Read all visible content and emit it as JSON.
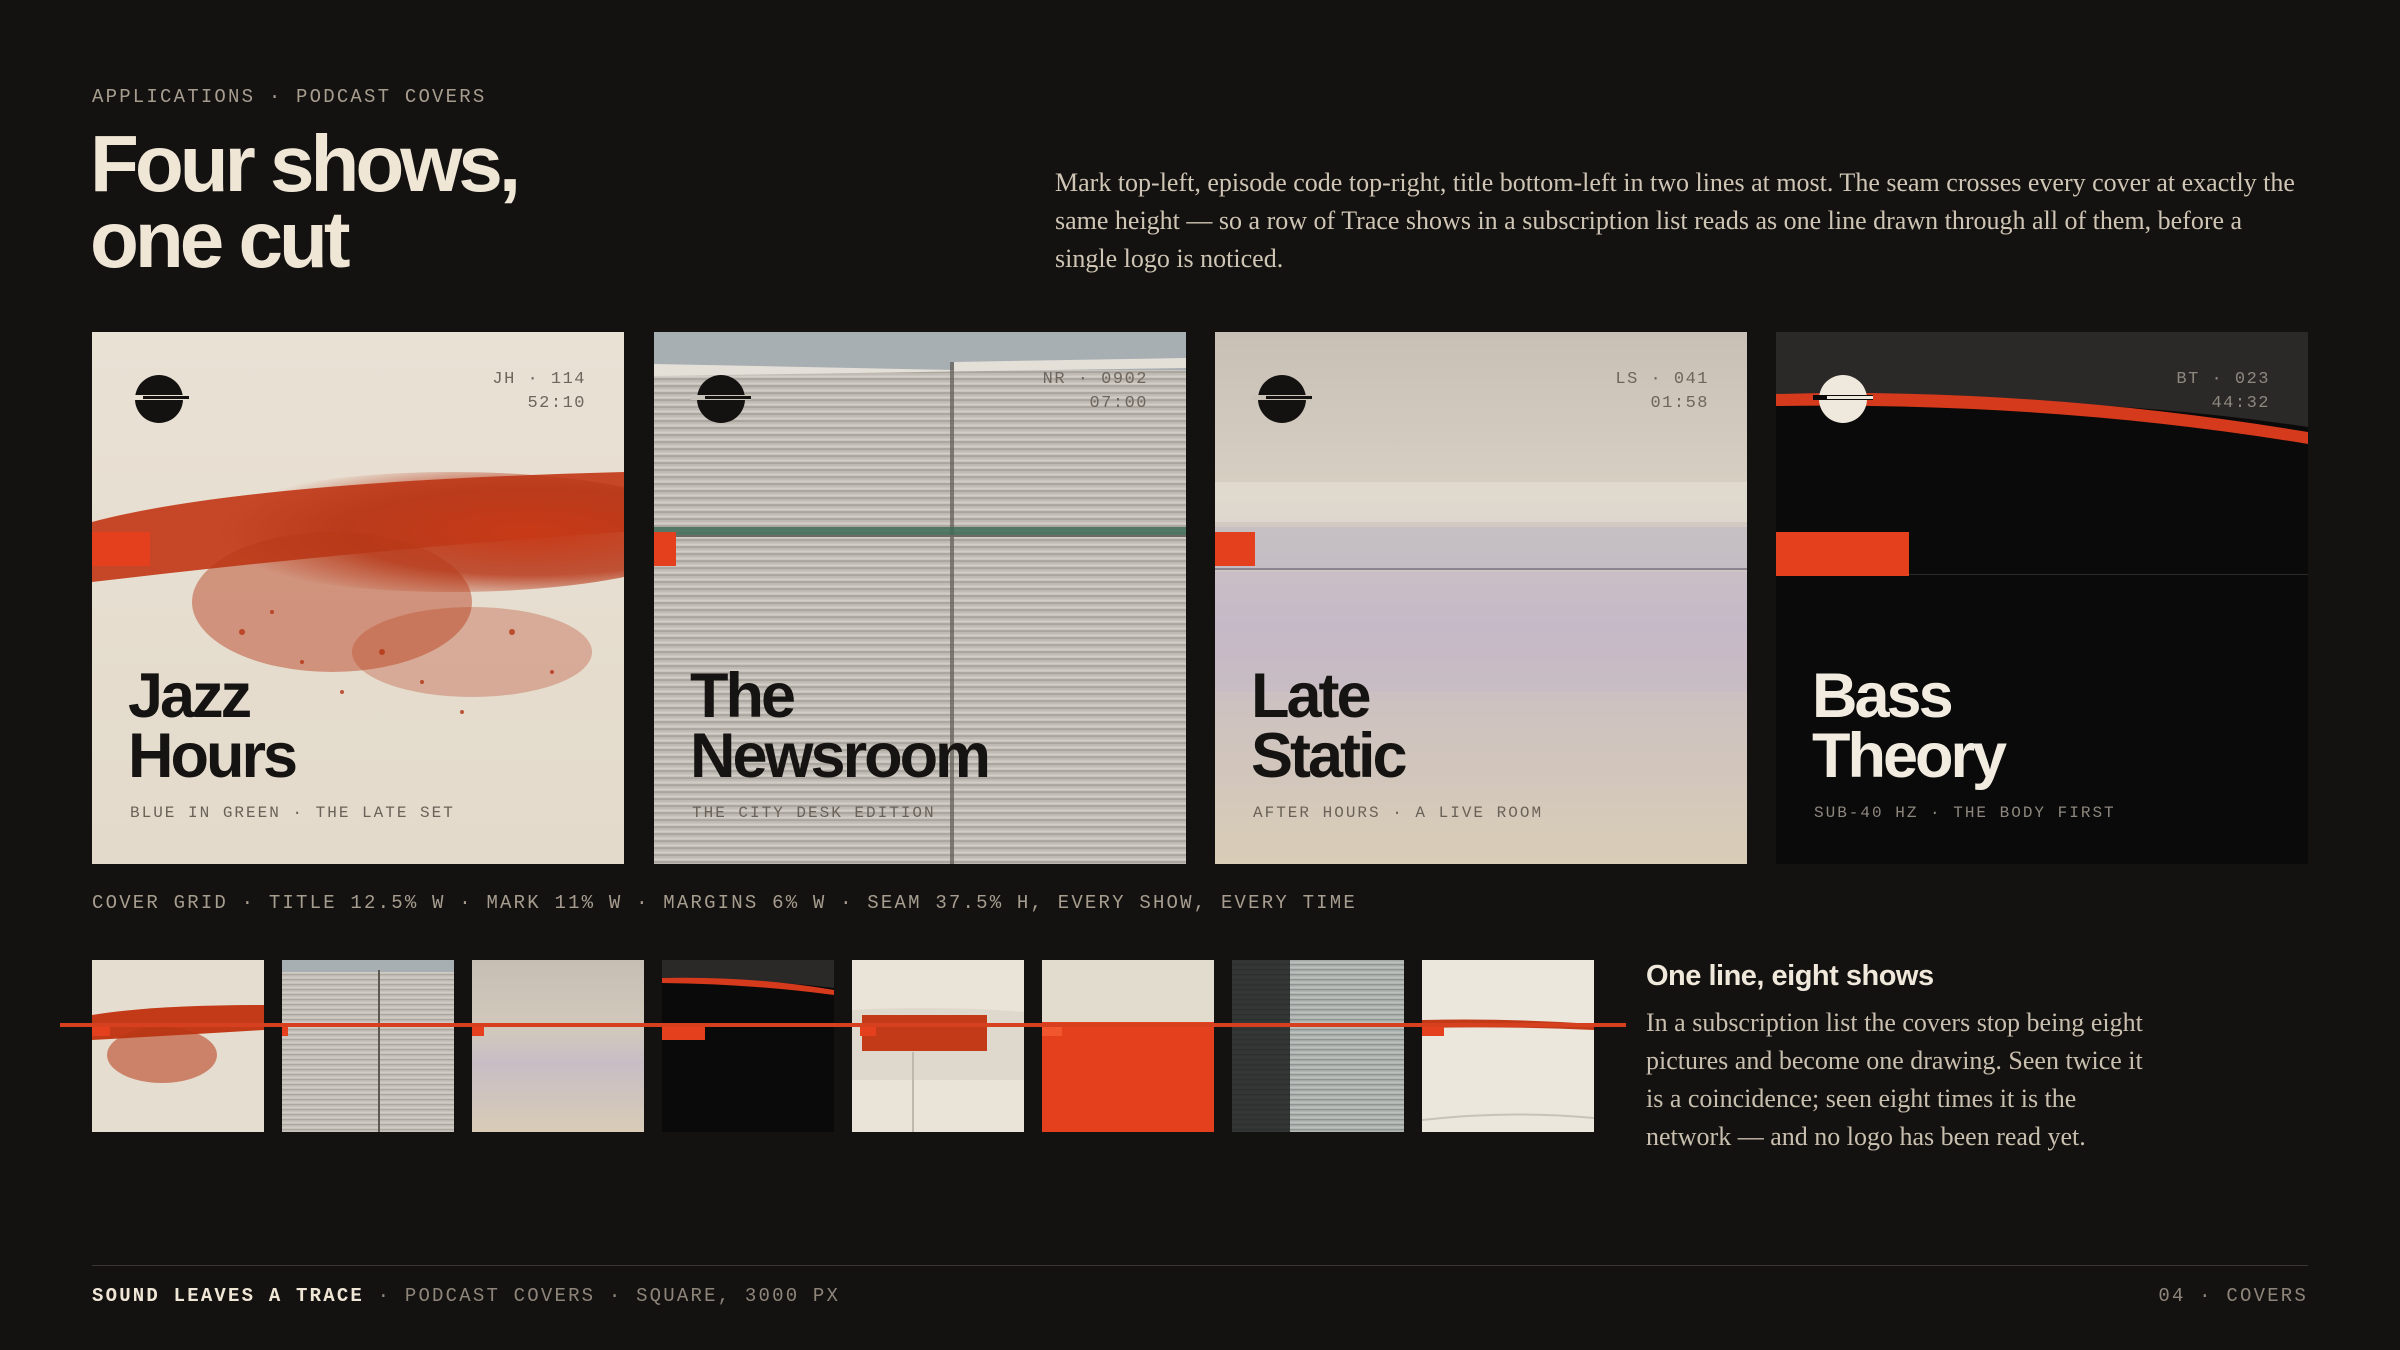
{
  "header": {
    "eyebrow": "APPLICATIONS · PODCAST COVERS",
    "title_line1": "Four shows,",
    "title_line2": "one cut",
    "intro": "Mark top-left, episode code top-right, title bottom-left in two lines at most. The seam crosses every cover at exactly the same height — so a row of Trace shows in a subscription list reads as one line drawn through all of them, before a single logo is noticed."
  },
  "covers": [
    {
      "code_line1": "JH · 114",
      "code_line2": "52:10",
      "title_line1": "Jazz",
      "title_line2": "Hours",
      "subtitle": "BLUE IN GREEN · THE LATE SET"
    },
    {
      "code_line1": "NR · 0902",
      "code_line2": "07:00",
      "title_line1": "The",
      "title_line2": "Newsroom",
      "subtitle": "THE CITY DESK EDITION"
    },
    {
      "code_line1": "LS · 041",
      "code_line2": "01:58",
      "title_line1": "Late",
      "title_line2": "Static",
      "subtitle": "AFTER HOURS · A LIVE ROOM"
    },
    {
      "code_line1": "BT · 023",
      "code_line2": "44:32",
      "title_line1": "Bass",
      "title_line2": "Theory",
      "subtitle": "SUB-40 HZ · THE BODY FIRST"
    }
  ],
  "grid_caption": "COVER GRID · TITLE 12.5% W · MARK 11% W · MARGINS 6% W · SEAM 37.5% H, EVERY SHOW, EVERY TIME",
  "side": {
    "title": "One line, eight shows",
    "body": "In a subscription list the covers stop being eight pictures and become one drawing. Seen twice it is a coincidence; seen eight times it is the network — and no logo has been read yet."
  },
  "footer": {
    "brand": "SOUND LEAVES A TRACE",
    "rest": " · PODCAST COVERS · SQUARE, 3000 PX",
    "right": "04 · COVERS"
  },
  "colors": {
    "background": "#141211",
    "accent": "#e4401e",
    "text": "#ece4d6",
    "muted": "#a79d8f"
  },
  "icons": {
    "brand_mark": "trace-mark-icon"
  }
}
